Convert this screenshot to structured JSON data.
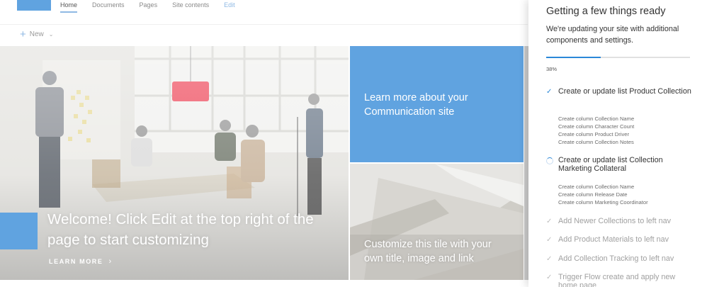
{
  "nav": {
    "tabs": [
      {
        "label": "Home"
      },
      {
        "label": "Documents"
      },
      {
        "label": "Pages"
      },
      {
        "label": "Site contents"
      },
      {
        "label": "Edit"
      }
    ]
  },
  "command_bar": {
    "new_label": "New"
  },
  "hero": {
    "title": "Welcome! Click Edit at the top right of the page to start customizing",
    "link_label": "LEARN MORE"
  },
  "tiles": [
    {
      "text": "Learn more about your Communication site"
    },
    {
      "text": "Customize this tile with your own title, image and link"
    }
  ],
  "panel": {
    "title": "Getting a few things ready",
    "subtitle": "We're updating your site with additional components and settings.",
    "progress": 0.38,
    "progress_label": "38%",
    "steps": [
      {
        "label": "Create or update list Product Collection",
        "status": "done",
        "subitems": [
          "Create column Collection Name",
          "Create column Character Count",
          "Create column Product Driver",
          "Create column Collection Notes"
        ]
      },
      {
        "label": "Create or update list Collection Marketing Collateral",
        "status": "in-progress",
        "subitems": [
          "Create column Collection Name",
          "Create column Release Date",
          "Create column Marketing Coordinator"
        ]
      },
      {
        "label": "Add Newer Collections to left nav",
        "status": "pending"
      },
      {
        "label": "Add Product Materials to left nav",
        "status": "pending"
      },
      {
        "label": "Add Collection Tracking to left nav",
        "status": "pending"
      },
      {
        "label": "Trigger Flow create and apply new home page",
        "status": "pending"
      }
    ]
  },
  "colors": {
    "accent": "#60a3e0",
    "progress": "#2b88d8"
  }
}
